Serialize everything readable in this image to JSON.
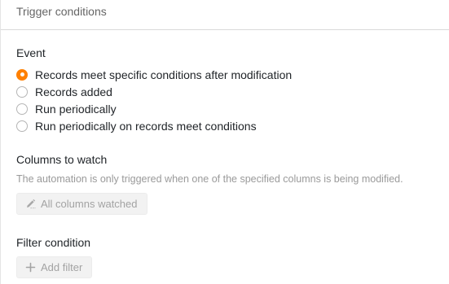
{
  "header": {
    "title": "Trigger conditions"
  },
  "event": {
    "title": "Event",
    "options": [
      {
        "label": "Records meet specific conditions after modification",
        "checked": true
      },
      {
        "label": "Records added",
        "checked": false
      },
      {
        "label": "Run periodically",
        "checked": false
      },
      {
        "label": "Run periodically on records meet conditions",
        "checked": false
      }
    ]
  },
  "columns_to_watch": {
    "title": "Columns to watch",
    "description": "The automation is only triggered when one of the specified columns is being modified.",
    "button_label": "All columns watched",
    "button_icon": "pencil-icon"
  },
  "filter_condition": {
    "title": "Filter condition",
    "button_label": "Add filter",
    "button_icon": "plus-icon"
  },
  "colors": {
    "accent": "#ff8000",
    "muted_text": "#9a9a9a",
    "button_bg": "#f2f2f2"
  }
}
